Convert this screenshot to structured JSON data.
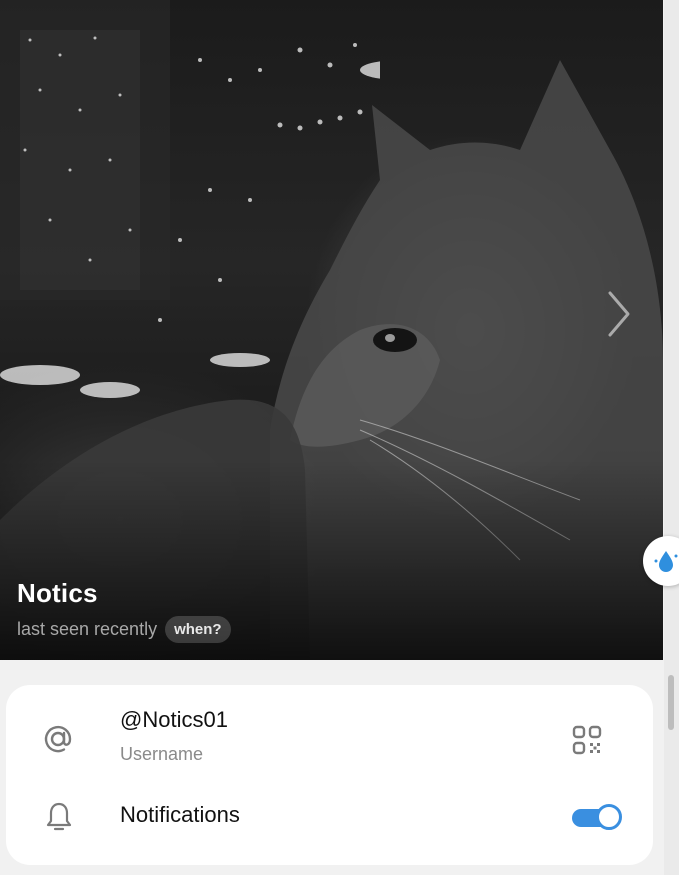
{
  "profile": {
    "name": "Notics",
    "status": "last seen recently",
    "when_label": "when?",
    "photo_description_icon": "cat-photo"
  },
  "info": {
    "username_value": "@Notics01",
    "username_label": "Username",
    "notifications_label": "Notifications",
    "notifications_enabled": true
  },
  "icons": {
    "at": "at-icon",
    "qr": "qr-code-icon",
    "bell": "bell-icon",
    "next": "chevron-right-icon",
    "bubble": "droplet-icon"
  },
  "colors": {
    "accent": "#3a8fe0",
    "background": "#f1f1f1",
    "card": "#ffffff"
  }
}
